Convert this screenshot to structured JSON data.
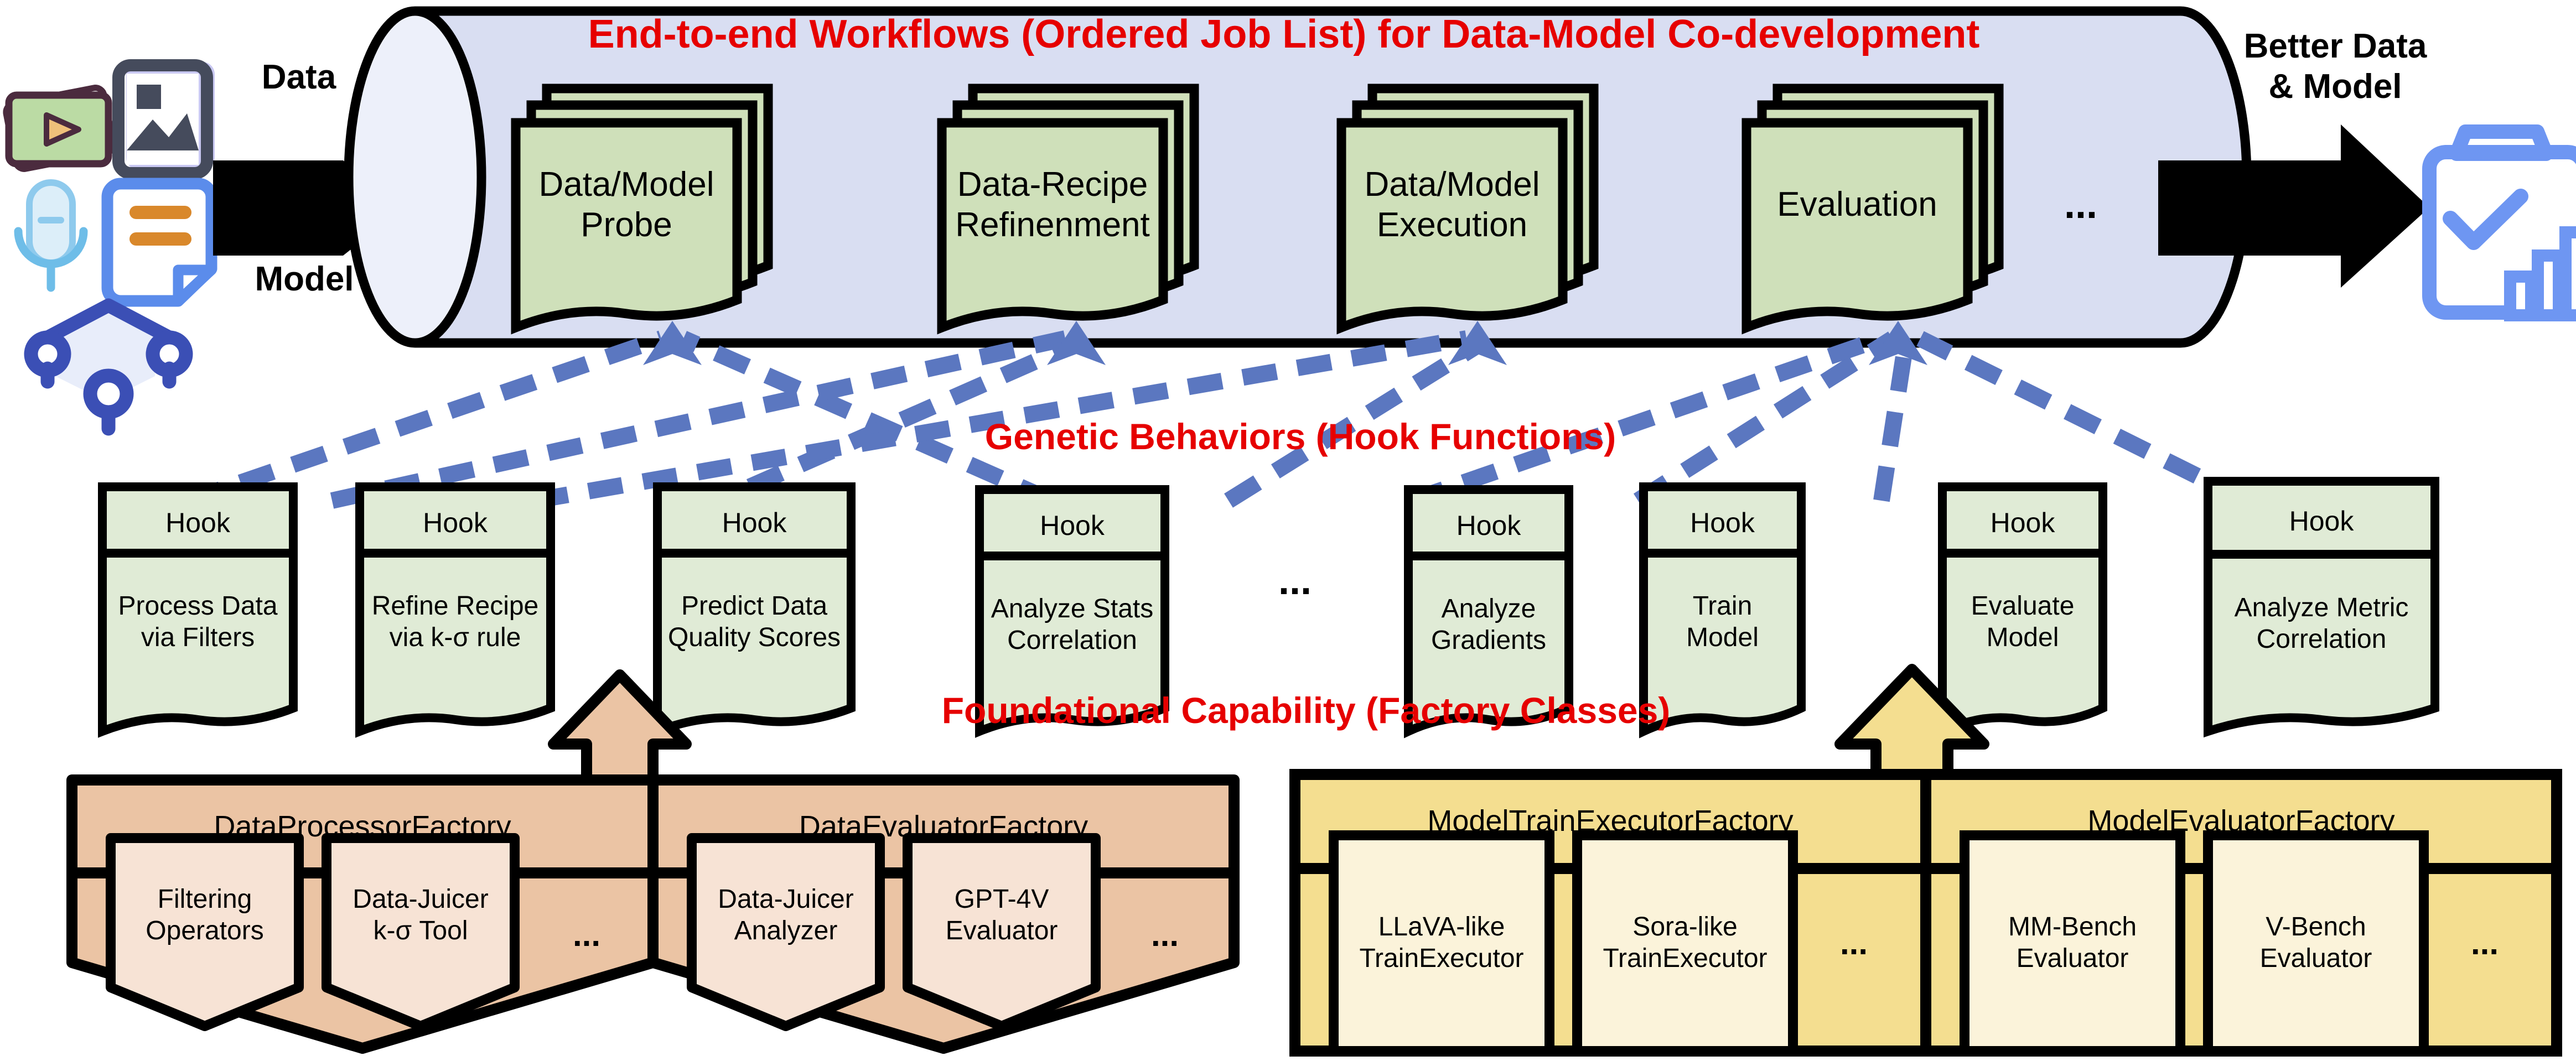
{
  "pipeline": {
    "title": "End-to-end Workflows (Ordered Job List) for Data-Model Co-development",
    "input_labels": {
      "data": "Data",
      "model": "Model"
    },
    "output_label": "Better Data\n& Model",
    "ellipsis": "...",
    "jobs": [
      {
        "label": "Data/Model\nProbe"
      },
      {
        "label": "Data-Recipe\nRefinenment"
      },
      {
        "label": "Data/Model\nExecution"
      },
      {
        "label": "Evaluation"
      }
    ]
  },
  "hooks_section": {
    "title": "Genetic Behaviors (Hook Functions)",
    "ellipsis": "...",
    "hook_label": "Hook",
    "hooks": [
      {
        "title": "Hook",
        "desc": "Process Data\nvia Filters"
      },
      {
        "title": "Hook",
        "desc": "Refine Recipe\nvia k-σ rule"
      },
      {
        "title": "Hook",
        "desc": "Predict Data\nQuality Scores"
      },
      {
        "title": "Hook",
        "desc": "Analyze Stats\nCorrelation"
      },
      {
        "title": "Hook",
        "desc": "Analyze\nGradients"
      },
      {
        "title": "Hook",
        "desc": "Train\nModel"
      },
      {
        "title": "Hook",
        "desc": "Evaluate\nModel"
      },
      {
        "title": "Hook",
        "desc": "Analyze Metric\nCorrelation"
      }
    ]
  },
  "factory_section": {
    "title": "Foundational Capability (Factory Classes)",
    "ellipsis": "...",
    "groups": [
      {
        "name": "data-factories",
        "factories": [
          {
            "title": "DataProcessorFactory",
            "items": [
              {
                "label": "Filtering\nOperators"
              },
              {
                "label": "Data-Juicer\nk-σ Tool"
              }
            ],
            "ellipsis": "..."
          },
          {
            "title": "DataEvaluatorFactory",
            "items": [
              {
                "label": "Data-Juicer\nAnalyzer"
              },
              {
                "label": "GPT-4V\nEvaluator"
              }
            ],
            "ellipsis": "..."
          }
        ]
      },
      {
        "name": "model-factories",
        "factories": [
          {
            "title": "ModelTrainExecutorFactory",
            "items": [
              {
                "label": "LLaVA-like\nTrainExecutor"
              },
              {
                "label": "Sora-like\nTrainExecutor"
              }
            ],
            "ellipsis": "..."
          },
          {
            "title": "ModelEvaluatorFactory",
            "items": [
              {
                "label": "MM-Bench\nEvaluator"
              },
              {
                "label": "V-Bench\nEvaluator"
              }
            ],
            "ellipsis": "..."
          }
        ]
      }
    ]
  },
  "icons": {
    "left": [
      {
        "name": "video-clapperboard-icon"
      },
      {
        "name": "image-picture-icon"
      },
      {
        "name": "microphone-icon"
      },
      {
        "name": "text-document-icon"
      },
      {
        "name": "model-node-graph-icon"
      }
    ],
    "right": [
      {
        "name": "clipboard-check-chart-icon"
      }
    ]
  },
  "colors": {
    "cylinder_body": "#D9DEF2",
    "cylinder_cap": "#EDF0FA",
    "job_green": "#CFE0BA",
    "hook_green": "#E0EBD6",
    "tan_factory": "#EBC4A4",
    "tan_item": "#F7E3D5",
    "yellow_factory": "#F4DE90",
    "yellow_item": "#FBF3DA",
    "arrow_blue": "#5B77C0",
    "title_red": "#E60000",
    "outline": "#000000"
  }
}
